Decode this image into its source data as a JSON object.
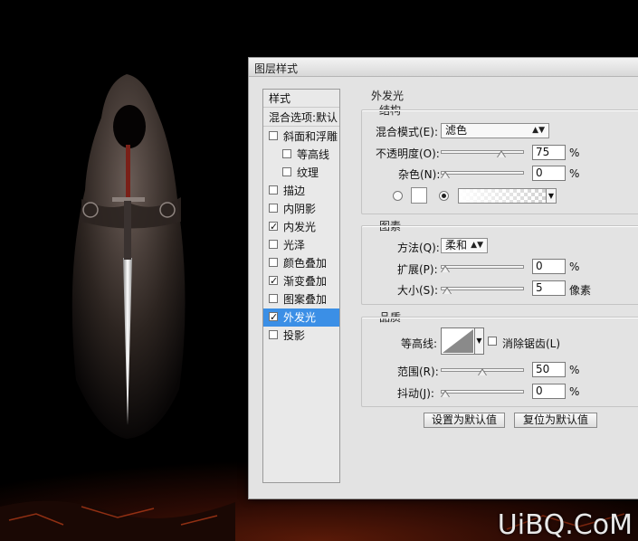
{
  "watermark": "UiBQ.CoM",
  "dialog": {
    "title": "图层样式",
    "styles_header": "样式",
    "blend_options": "混合选项:默认",
    "style_items": [
      {
        "label": "斜面和浮雕",
        "checked": false,
        "indent": false
      },
      {
        "label": "等高线",
        "checked": false,
        "indent": true
      },
      {
        "label": "纹理",
        "checked": false,
        "indent": true
      },
      {
        "label": "描边",
        "checked": false,
        "indent": false
      },
      {
        "label": "内阴影",
        "checked": false,
        "indent": false
      },
      {
        "label": "内发光",
        "checked": true,
        "indent": false
      },
      {
        "label": "光泽",
        "checked": false,
        "indent": false
      },
      {
        "label": "颜色叠加",
        "checked": false,
        "indent": false
      },
      {
        "label": "渐变叠加",
        "checked": true,
        "indent": false
      },
      {
        "label": "图案叠加",
        "checked": false,
        "indent": false
      },
      {
        "label": "外发光",
        "checked": true,
        "indent": false,
        "selected": true
      },
      {
        "label": "投影",
        "checked": false,
        "indent": false
      }
    ],
    "section_title": "外发光",
    "structure": {
      "title": "结构",
      "blend_mode_label": "混合模式(E):",
      "blend_mode_value": "滤色",
      "opacity_label": "不透明度(O):",
      "opacity_value": "75",
      "opacity_unit": "%",
      "opacity_level": 0.75,
      "noise_label": "杂色(N):",
      "noise_value": "0",
      "noise_unit": "%",
      "noise_level": 0
    },
    "elements": {
      "title": "图素",
      "method_label": "方法(Q):",
      "method_value": "柔和",
      "spread_label": "扩展(P):",
      "spread_value": "0",
      "spread_unit": "%",
      "spread_level": 0,
      "size_label": "大小(S):",
      "size_value": "5",
      "size_unit": "像素",
      "size_level": 0.02
    },
    "quality": {
      "title": "品质",
      "contour_label": "等高线:",
      "antialias_label": "消除锯齿(L)",
      "antialias_checked": false,
      "range_label": "范围(R):",
      "range_value": "50",
      "range_unit": "%",
      "range_level": 0.5,
      "jitter_label": "抖动(J):",
      "jitter_value": "0",
      "jitter_unit": "%",
      "jitter_level": 0
    },
    "buttons": {
      "set_default": "设置为默认值",
      "reset_default": "复位为默认值"
    }
  },
  "colors": {
    "selection": "#3b8fe6",
    "dialog_bg": "#e3e3e3"
  }
}
